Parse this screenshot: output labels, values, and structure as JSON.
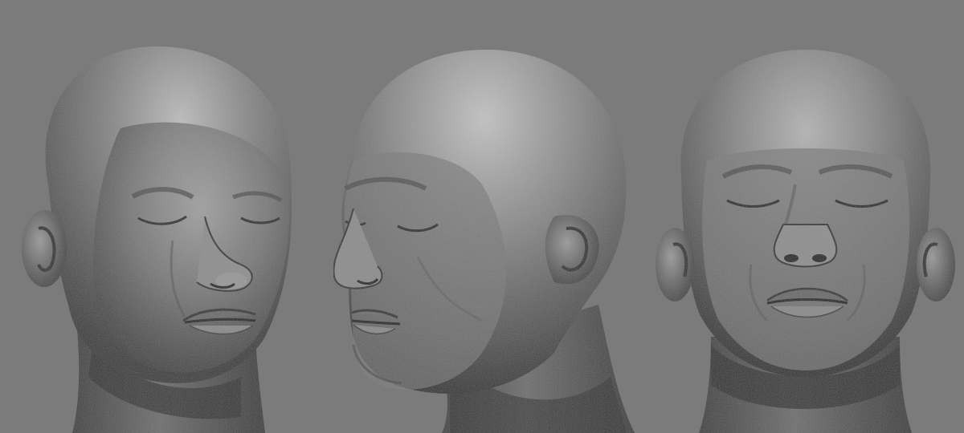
{
  "scene": {
    "background_color": "#7b7b7b",
    "clay_base_color": "#5e5e5e",
    "clay_highlight_color": "#bdbdbd",
    "clay_shadow_color": "#2a2a2a"
  },
  "views": [
    {
      "view": "three-quarter",
      "eyes": "closed"
    },
    {
      "view": "profile-left",
      "eyes": "closed"
    },
    {
      "view": "front-low-angle",
      "eyes": "closed"
    }
  ]
}
